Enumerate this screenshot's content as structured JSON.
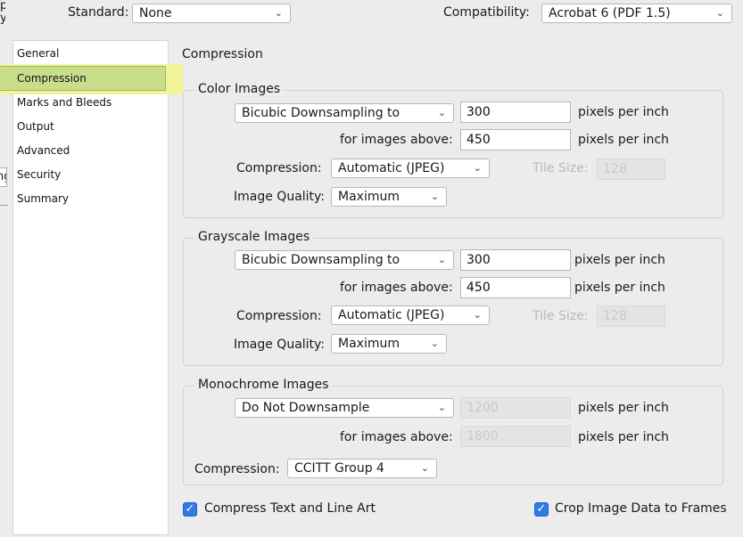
{
  "header": {
    "standard_label": "Standard:",
    "standard_value": "None",
    "compatibility_label": "Compatibility:",
    "compatibility_value": "Acrobat 6 (PDF 1.5)"
  },
  "left_edge": {
    "frag_top1": "p",
    "frag_top2": "y",
    "frag_mid": "ng"
  },
  "sidebar": {
    "items": [
      {
        "label": "General"
      },
      {
        "label": "Compression"
      },
      {
        "label": "Marks and Bleeds"
      },
      {
        "label": "Output"
      },
      {
        "label": "Advanced"
      },
      {
        "label": "Security"
      },
      {
        "label": "Summary"
      }
    ],
    "selected": "Compression",
    "highlight_color": "#c9de8b"
  },
  "panel": {
    "title": "Compression"
  },
  "color_images": {
    "title": "Color Images",
    "downsample": "Bicubic Downsampling to",
    "ppi_value": "300",
    "ppi_unit": "pixels per inch",
    "above_label": "for images above:",
    "above_value": "450",
    "above_unit": "pixels per inch",
    "compression_label": "Compression:",
    "compression_value": "Automatic (JPEG)",
    "tile_label": "Tile Size:",
    "tile_value": "128",
    "quality_label": "Image Quality:",
    "quality_value": "Maximum"
  },
  "grayscale_images": {
    "title": "Grayscale Images",
    "downsample": "Bicubic Downsampling to",
    "ppi_value": "300",
    "ppi_unit": "pixels per inch",
    "above_label": "for images above:",
    "above_value": "450",
    "above_unit": "pixels per inch",
    "compression_label": "Compression:",
    "compression_value": "Automatic (JPEG)",
    "tile_label": "Tile Size:",
    "tile_value": "128",
    "quality_label": "Image Quality:",
    "quality_value": "Maximum"
  },
  "monochrome_images": {
    "title": "Monochrome Images",
    "downsample": "Do Not Downsample",
    "ppi_value": "1200",
    "ppi_unit": "pixels per inch",
    "above_label": "for images above:",
    "above_value": "1800",
    "above_unit": "pixels per inch",
    "compression_label": "Compression:",
    "compression_value": "CCITT Group 4"
  },
  "options": {
    "compress_text_label": "Compress Text and Line Art",
    "compress_text_checked": true,
    "crop_label": "Crop Image Data to Frames",
    "crop_checked": true
  },
  "icons": {
    "dropdown": "chevron-down-icon",
    "check": "checkmark-icon"
  }
}
